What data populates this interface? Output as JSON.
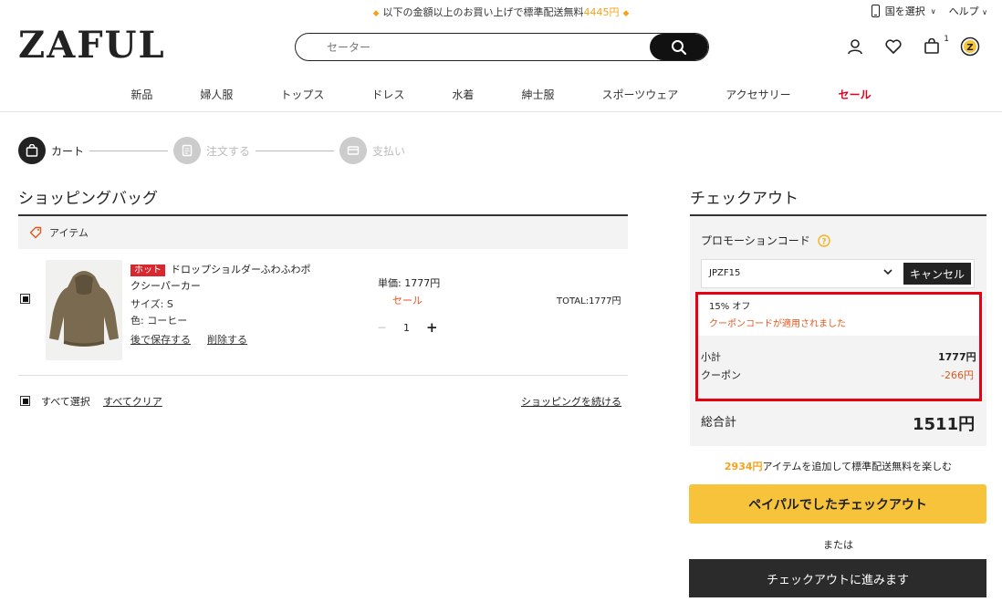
{
  "topbar": {
    "promo_text": "以下の金額以上のお買い上げで標準配送無料",
    "promo_amount": "4445円",
    "country": "国を選択",
    "help": "ヘルプ"
  },
  "header": {
    "logo": "ZAFUL",
    "search_placeholder": "セーター",
    "cart_count": "1"
  },
  "nav": {
    "items": [
      "新品",
      "婦人服",
      "トップス",
      "ドレス",
      "水着",
      "紳士服",
      "スポーツウェア",
      "アクセサリー"
    ],
    "sale": "セール"
  },
  "steps": [
    {
      "label": "カート"
    },
    {
      "label": "注文する"
    },
    {
      "label": "支払い"
    }
  ],
  "bag": {
    "title": "ショッピングバッグ",
    "items_header": "アイテム",
    "item": {
      "badge": "ホット",
      "name": "ドロップショルダーふわふわポクシーパーカー",
      "size": "サイズ: S",
      "color": "色: コーヒー",
      "save_later": "後で保存する",
      "delete": "削除する",
      "unit_price": "単価: 1777円",
      "sale_label": "セール",
      "quantity": "1",
      "minus": "－",
      "plus": "+",
      "total": "TOTAL:1777円"
    },
    "select_all": "すべて選択",
    "clear_all": "すべてクリア",
    "continue_shopping": "ショッピングを続ける"
  },
  "checkout": {
    "title": "チェックアウト",
    "promo_label": "プロモーションコード",
    "promo_code": "JPZF15",
    "cancel": "キャンセル",
    "discount": "15% オフ",
    "applied": "クーポンコードが適用されました",
    "subtotal_label": "小計",
    "subtotal": "1777円",
    "coupon_label": "クーポン",
    "coupon": "-266円",
    "total_label": "総合計",
    "total": "1511円",
    "free_ship_amount": "2934円",
    "free_ship_text": "アイテムを追加して標準配送無料を楽しむ",
    "paypal": "ペイパルでしたチェックアウト",
    "or": "または",
    "proceed": "チェックアウトに進みます"
  },
  "colors": {
    "accent_orange": "#f7a21b",
    "sale_red": "#e4001b",
    "paypal_yellow": "#f6c33a",
    "highlight_red": "#e60012"
  }
}
